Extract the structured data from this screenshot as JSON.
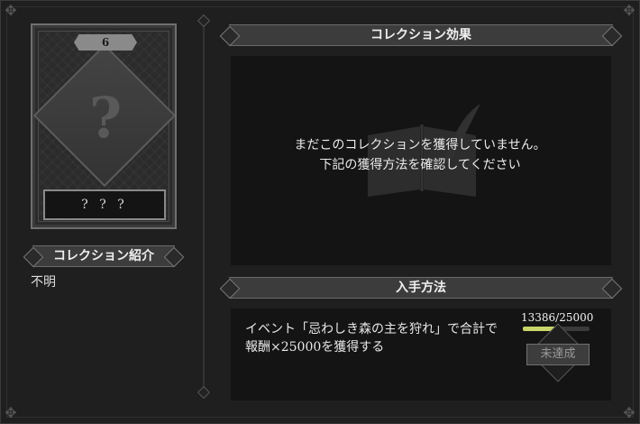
{
  "card": {
    "number": "6",
    "name": "? ? ?"
  },
  "intro": {
    "header": "コレクション紹介",
    "text": "不明"
  },
  "effect": {
    "header": "コレクション効果",
    "message_line1": "まだこのコレクションを獲得していません。",
    "message_line2": "下記の獲得方法を確認してください"
  },
  "method": {
    "header": "入手方法",
    "description": "イベント「忌わしき森の主を狩れ」で合計で報酬×25000を獲得する",
    "progress_text": "13386/25000",
    "progress_fraction": 0.535,
    "status": "未達成"
  },
  "colors": {
    "progress_fill": "#c8d66a",
    "panel_bg": "#141414",
    "page_bg": "#1f1f1f"
  }
}
